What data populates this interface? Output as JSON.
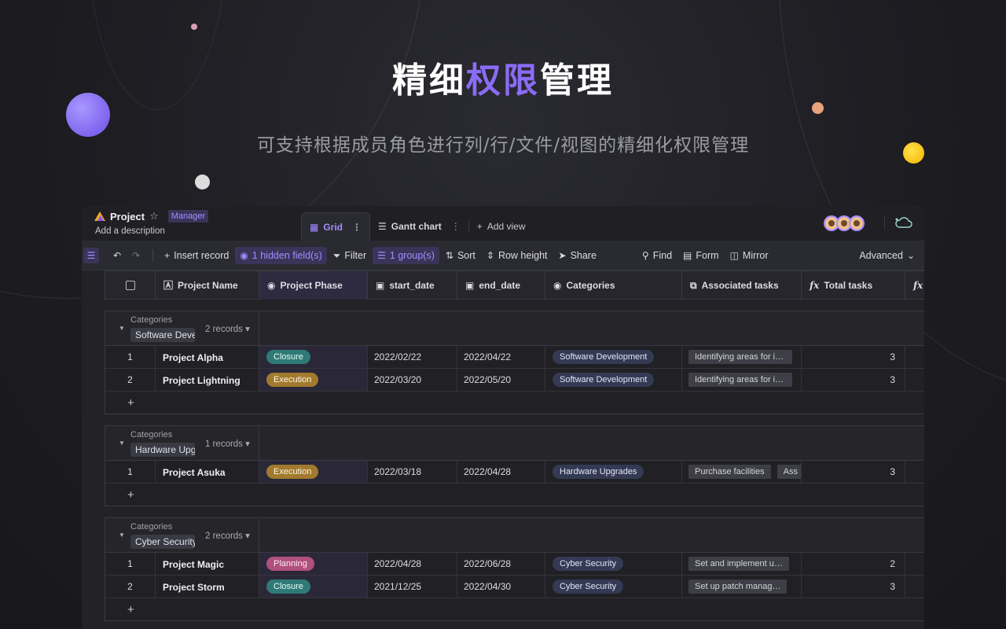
{
  "hero": {
    "title_a": "精细",
    "title_accent": "权限",
    "title_b": "管理",
    "subtitle": "可支持根据成员角色进行列/行/文件/视图的精细化权限管理"
  },
  "colors": {
    "accent": "#8b6cf6",
    "closure": "#2f7a76",
    "execution": "#a27a2e",
    "planning": "#b0507d"
  },
  "topbar": {
    "project_name": "Project",
    "role": "Manager",
    "description": "Add a description",
    "tabs": [
      {
        "label": "Grid",
        "icon": "grid-icon",
        "active": true
      },
      {
        "label": "Gantt chart",
        "icon": "gantt-icon",
        "active": false
      }
    ],
    "add_view": "Add view"
  },
  "toolbar": {
    "insert": "Insert record",
    "hidden": "1 hidden field(s)",
    "filter": "Filter",
    "group": "1 group(s)",
    "sort": "Sort",
    "row_height": "Row height",
    "share": "Share",
    "find": "Find",
    "form": "Form",
    "mirror": "Mirror",
    "advanced": "Advanced"
  },
  "columns": {
    "name": "Project Name",
    "phase": "Project Phase",
    "start": "start_date",
    "end": "end_date",
    "categories": "Categories",
    "associated": "Associated tasks",
    "total": "Total tasks"
  },
  "groups": [
    {
      "label": "Categories",
      "value": "Software Development",
      "count": "2 records",
      "rows": [
        {
          "num": "1",
          "name": "Project Alpha",
          "phase": "Closure",
          "phase_class": "closure",
          "start": "2022/02/22",
          "end": "2022/04/22",
          "category": "Software Development",
          "tasks": [
            "Identifying areas for improvement"
          ],
          "total": "3"
        },
        {
          "num": "2",
          "name": "Project Lightning",
          "phase": "Execution",
          "phase_class": "execution",
          "start": "2022/03/20",
          "end": "2022/05/20",
          "category": "Software Development",
          "tasks": [
            "Identifying areas for improvement"
          ],
          "total": "3"
        }
      ]
    },
    {
      "label": "Categories",
      "value": "Hardware Upgrades",
      "count": "1 records",
      "rows": [
        {
          "num": "1",
          "name": "Project Asuka",
          "phase": "Execution",
          "phase_class": "execution",
          "start": "2022/03/18",
          "end": "2022/04/28",
          "category": "Hardware Upgrades",
          "tasks": [
            "Purchase facilities",
            "Ass"
          ],
          "total": "3"
        }
      ]
    },
    {
      "label": "Categories",
      "value": "Cyber Security",
      "count": "2 records",
      "rows": [
        {
          "num": "1",
          "name": "Project Magic",
          "phase": "Planning",
          "phase_class": "planning",
          "start": "2022/04/28",
          "end": "2022/06/28",
          "category": "Cyber Security",
          "tasks": [
            "Set and implement u…"
          ],
          "total": "2"
        },
        {
          "num": "2",
          "name": "Project Storm",
          "phase": "Closure",
          "phase_class": "closure",
          "start": "2021/12/25",
          "end": "2022/04/30",
          "category": "Cyber Security",
          "tasks": [
            "Set up patch manag…"
          ],
          "total": "3"
        }
      ]
    }
  ]
}
